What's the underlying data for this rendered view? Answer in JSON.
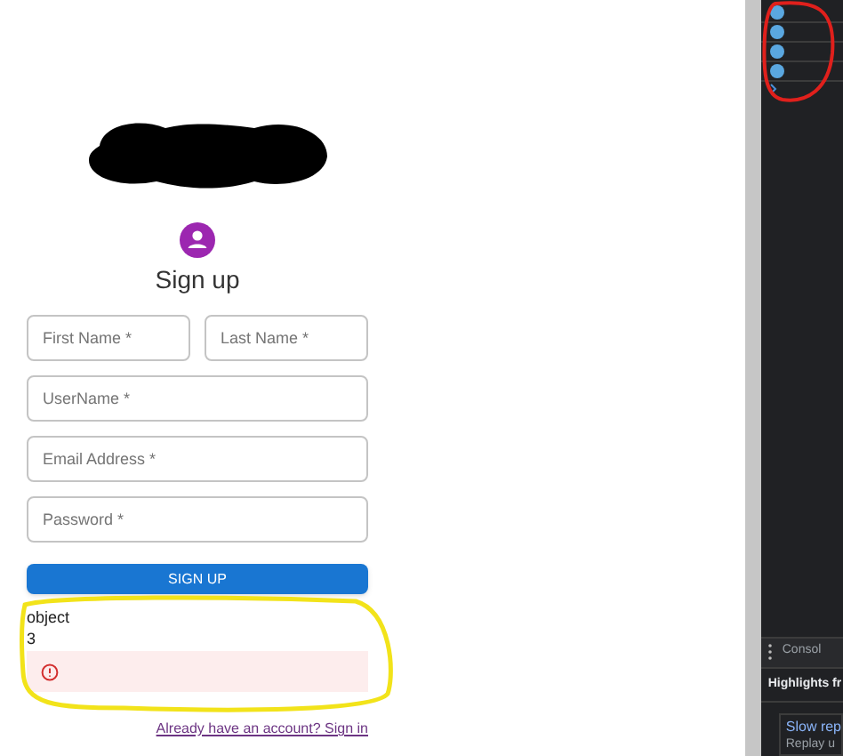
{
  "form": {
    "title": "Sign up",
    "fields": [
      {
        "placeholder": "First Name *"
      },
      {
        "placeholder": "Last Name *"
      },
      {
        "placeholder": "UserName *"
      },
      {
        "placeholder": "Email Address *"
      },
      {
        "placeholder": "Password *"
      }
    ],
    "submit": "SIGN UP",
    "debug_lines": [
      "object",
      "3"
    ],
    "alert": {
      "kind": "error"
    },
    "link": "Already have an account? Sign in"
  },
  "devtools": {
    "messages": [
      {
        "kind": "count"
      },
      {
        "kind": "count"
      },
      {
        "kind": "count"
      },
      {
        "kind": "count"
      }
    ],
    "tab": "Consol",
    "highlights": "Highlights fr",
    "card_title": "Slow rep",
    "card_text": "Replay u"
  }
}
